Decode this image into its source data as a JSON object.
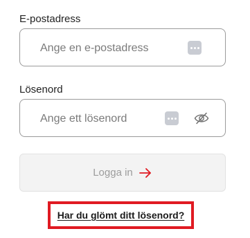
{
  "email": {
    "label": "E-postadress",
    "placeholder": "Ange en e-postadress",
    "value": ""
  },
  "password": {
    "label": "Lösenord",
    "placeholder": "Ange ett lösenord",
    "value": ""
  },
  "login_button": {
    "label": "Logga in",
    "icon": "arrow-right-icon"
  },
  "forgot_link": {
    "label": "Har du glömt ditt lösenord?"
  },
  "colors": {
    "accent": "#e01a22",
    "button_disabled_bg": "#f3f3f3",
    "button_disabled_text": "#9c9c9c",
    "field_border": "#9a9a9a",
    "pw_manager_badge": "#c9ccd3"
  },
  "icons": {
    "password_manager": "password-manager-icon",
    "visibility_toggle": "eye-off-icon"
  }
}
